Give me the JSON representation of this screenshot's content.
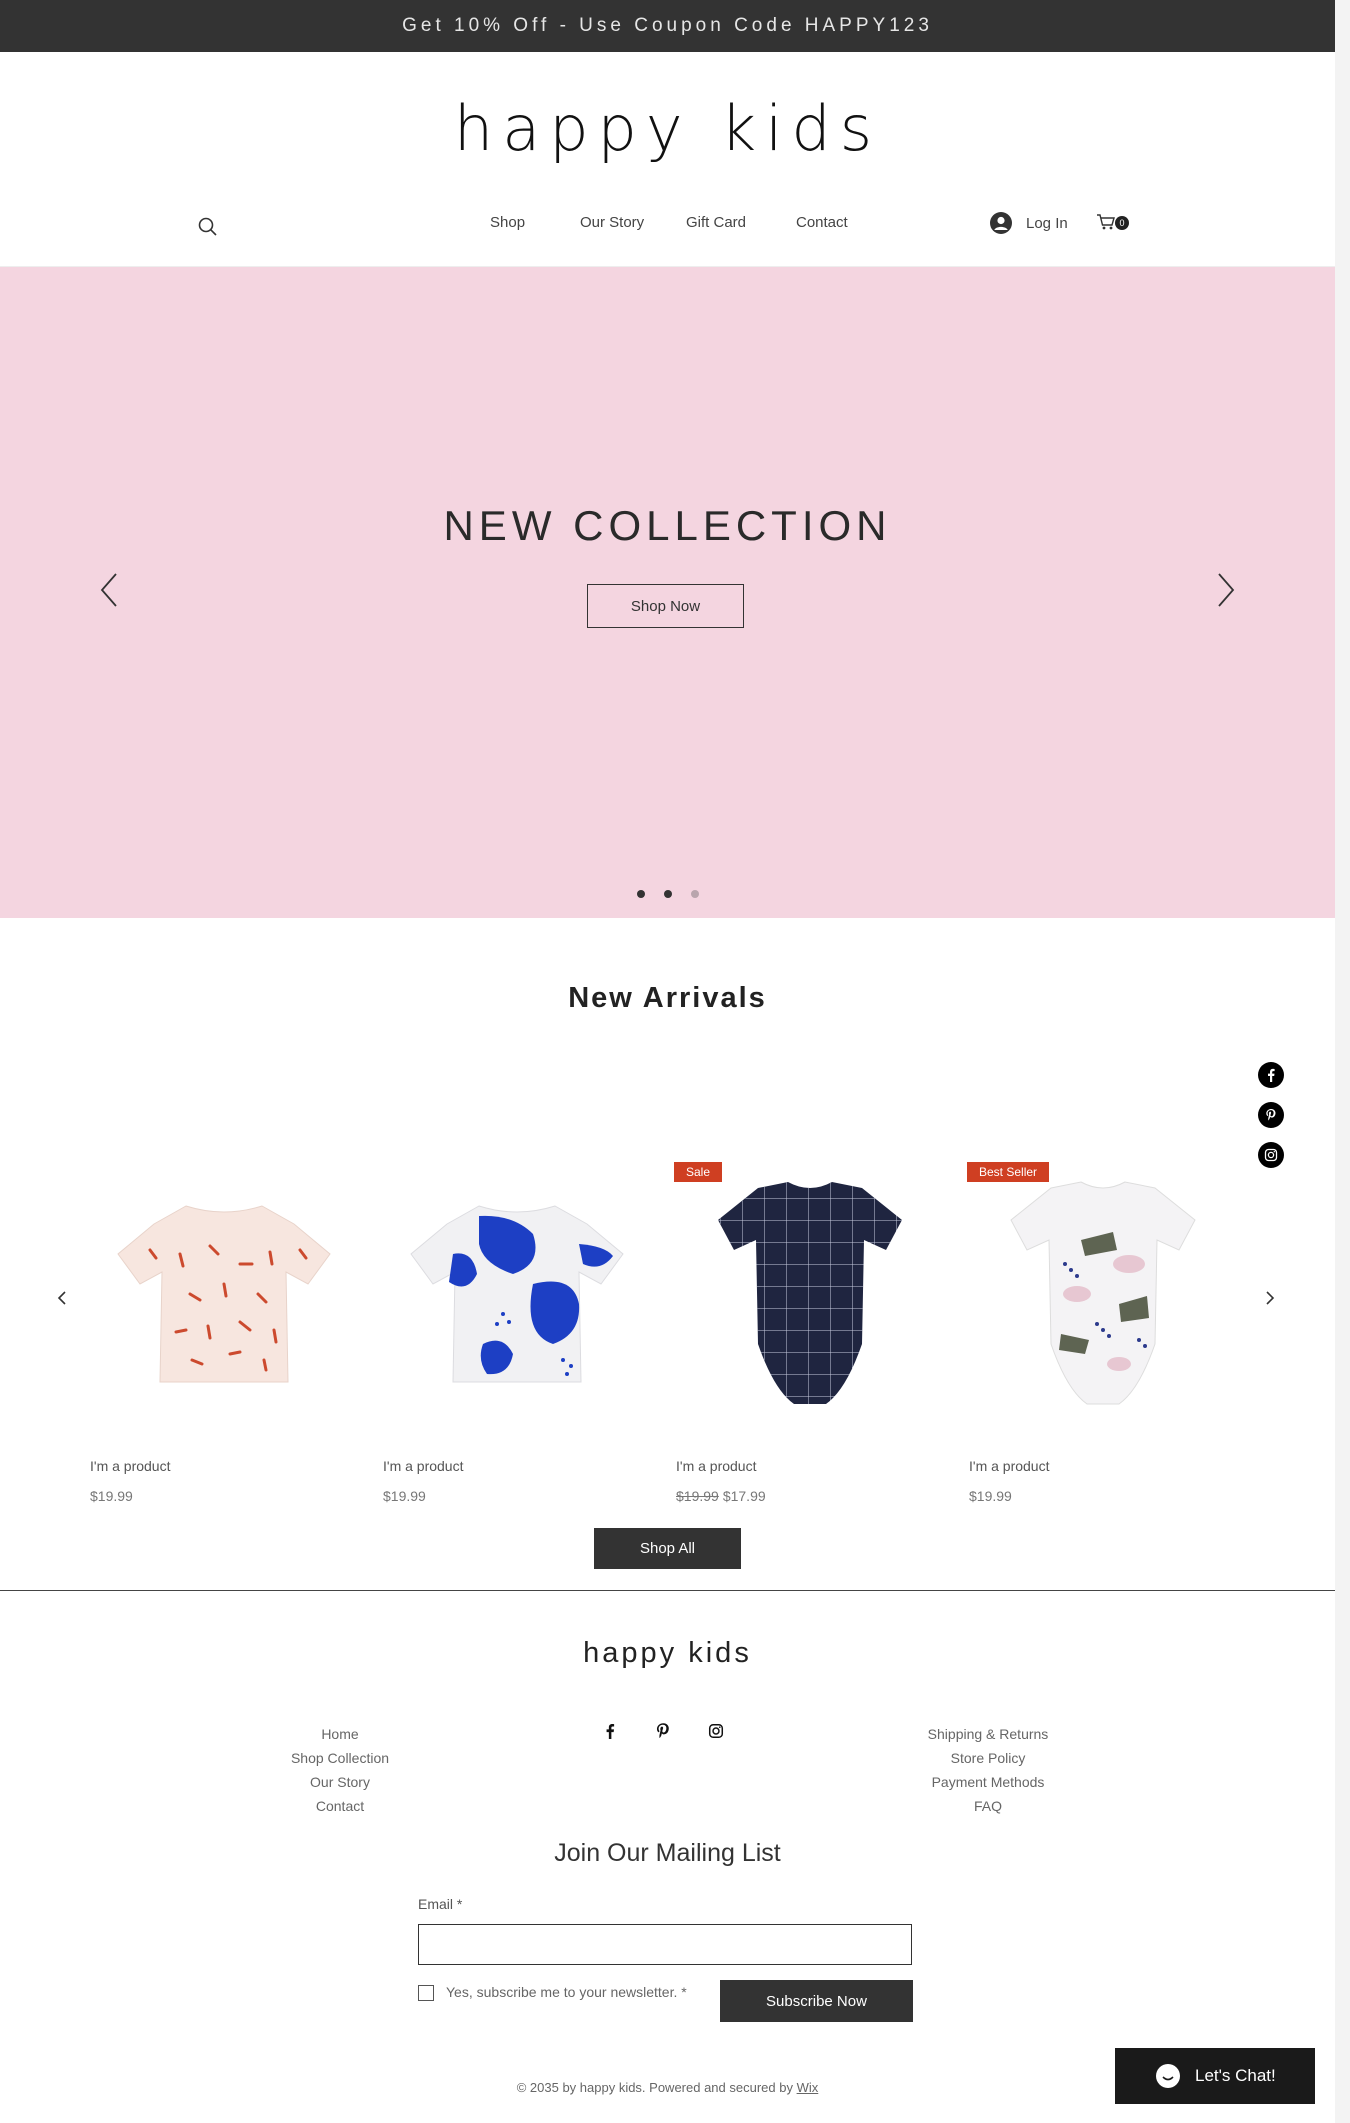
{
  "announcement": "Get 10% Off - Use Coupon Code HAPPY123",
  "brand": "happy kids",
  "nav": {
    "items": [
      "Shop",
      "Our Story",
      "Gift Card",
      "Contact"
    ]
  },
  "header": {
    "login_label": "Log In",
    "cart_count": "0"
  },
  "hero": {
    "title": "NEW COLLECTION",
    "button_label": "Shop Now",
    "slides": 3,
    "active_slide": 1
  },
  "new_arrivals": {
    "title": "New Arrivals",
    "products": [
      {
        "name": "I'm a product",
        "price": "$19.99",
        "old_price": "",
        "badge": ""
      },
      {
        "name": "I'm a product",
        "price": "$19.99",
        "old_price": "",
        "badge": ""
      },
      {
        "name": "I'm a product",
        "price": "$17.99",
        "old_price": "$19.99",
        "badge": "Sale"
      },
      {
        "name": "I'm a product",
        "price": "$19.99",
        "old_price": "",
        "badge": "Best Seller"
      }
    ],
    "shop_all_label": "Shop All"
  },
  "footer": {
    "brand": "happy kids",
    "left_links": [
      "Home",
      "Shop Collection",
      "Our Story",
      "Contact"
    ],
    "right_links": [
      "Shipping & Returns",
      "Store Policy",
      "Payment Methods",
      "FAQ"
    ],
    "social": [
      "facebook-icon",
      "pinterest-icon",
      "instagram-icon"
    ]
  },
  "mailing": {
    "title": "Join Our Mailing List",
    "email_label": "Email *",
    "email_value": "",
    "checkbox_label": "Yes, subscribe me to your newsletter. *",
    "subscribe_label": "Subscribe Now"
  },
  "copyright": {
    "text": "© 2035 by happy kids. Powered and secured by ",
    "link": "Wix"
  },
  "chat": {
    "label": "Let's Chat!"
  },
  "colors": {
    "hero_bg": "#f4d5e0",
    "dark": "#333333",
    "badge": "#cf3f22"
  }
}
